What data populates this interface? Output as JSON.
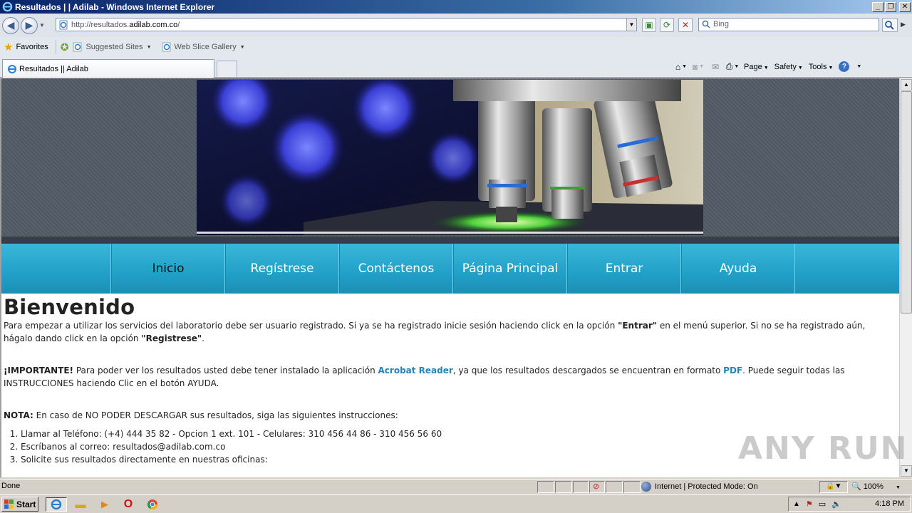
{
  "window": {
    "title": "Resultados | | Adilab - Windows Internet Explorer",
    "minimize": "_",
    "restore": "❐",
    "close": "✕"
  },
  "address": {
    "url_prefix": "http://resultados.",
    "url_domain": "adilab.com.co",
    "url_suffix": "/",
    "search_placeholder": "Bing"
  },
  "favorites": {
    "label": "Favorites",
    "items": [
      {
        "label": "Suggested Sites"
      },
      {
        "label": "Web Slice Gallery"
      }
    ]
  },
  "tab": {
    "title": "Resultados || Adilab"
  },
  "commandbar": {
    "page": "Page",
    "safety": "Safety",
    "tools": "Tools"
  },
  "site": {
    "menu": [
      {
        "label": "Inicio",
        "active": true
      },
      {
        "label": "Regístrese"
      },
      {
        "label": "Contáctenos"
      },
      {
        "label": "Página Principal"
      },
      {
        "label": "Entrar"
      },
      {
        "label": "Ayuda"
      }
    ],
    "heading": "Bienvenido",
    "intro_1": "Para empezar a utilizar los servicios del laboratorio debe ser usuario registrado. Si ya se ha registrado inicie sesión haciendo click en la opción ",
    "intro_entrar": "\"Entrar\"",
    "intro_2": " en el menú superior. Si no se ha registrado aún, hágalo dando click en la opción ",
    "intro_registrese": "\"Registrese\"",
    "intro_3": ".",
    "important_label": "¡IMPORTANTE!",
    "important_1": " Para poder ver los resultados usted debe tener instalado la aplicación ",
    "acrobat": "Acrobat Reader",
    "important_2": ", ya que los resultados descargados se encuentran en formato ",
    "pdf": "PDF",
    "important_3": ". Puede seguir todas las INSTRUCCIONES haciendo Clic en el botón AYUDA.",
    "note_label": "NOTA:",
    "note_text": " En caso de NO PODER DESCARGAR sus resultados, siga las siguientes instrucciones:",
    "steps": [
      "Llamar al Teléfono: (+4) 444 35 82 - Opcion 1 ext. 101 - Celulares: 310 456 44 86 - 310 456 56 60",
      "Escríbanos al correo: resultados@adilab.com.co",
      "Solicite sus resultados directamente en nuestras oficinas:"
    ]
  },
  "status": {
    "left": "Done",
    "zone": "Internet | Protected Mode: On",
    "zoom": "100%"
  },
  "taskbar": {
    "start": "Start",
    "clock": "4:18 PM"
  },
  "watermark": "ANY RUN"
}
